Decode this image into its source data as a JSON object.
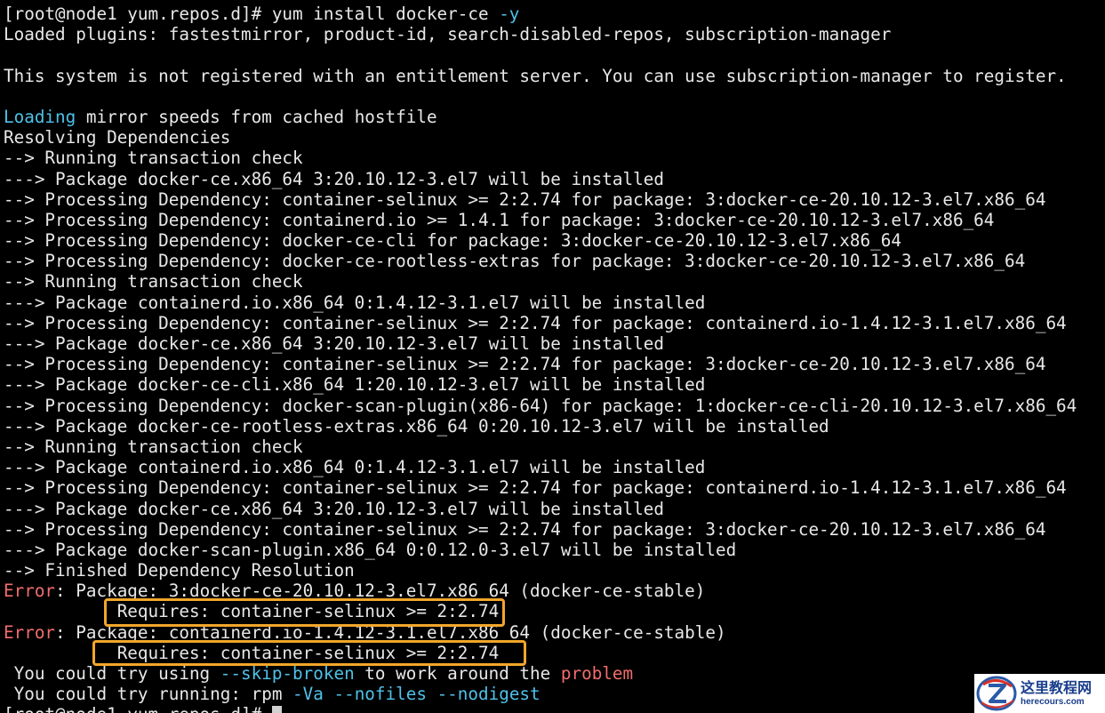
{
  "terminal": {
    "lines": [
      [
        {
          "t": "[root@node1 yum.repos.d]# yum install docker-ce "
        },
        {
          "t": "-y",
          "c": "cyan"
        }
      ],
      [
        {
          "t": "Loaded plugins: fastestmirror, product-id, search-disabled-repos, subscription-manager"
        }
      ],
      [],
      [
        {
          "t": "This system is not registered with an entitlement server. You can use subscription-manager to register."
        }
      ],
      [],
      [
        {
          "t": "Loading",
          "c": "cyan"
        },
        {
          "t": " mirror speeds from cached hostfile"
        }
      ],
      [
        {
          "t": "Resolving Dependencies"
        }
      ],
      [
        {
          "t": "--> Running transaction check"
        }
      ],
      [
        {
          "t": "---> Package docker-ce.x86_64 3:20.10.12-3.el7 will be installed"
        }
      ],
      [
        {
          "t": "--> Processing Dependency: container-selinux >= 2:2.74 for package: 3:docker-ce-20.10.12-3.el7.x86_64"
        }
      ],
      [
        {
          "t": "--> Processing Dependency: containerd.io >= 1.4.1 for package: 3:docker-ce-20.10.12-3.el7.x86_64"
        }
      ],
      [
        {
          "t": "--> Processing Dependency: docker-ce-cli for package: 3:docker-ce-20.10.12-3.el7.x86_64"
        }
      ],
      [
        {
          "t": "--> Processing Dependency: docker-ce-rootless-extras for package: 3:docker-ce-20.10.12-3.el7.x86_64"
        }
      ],
      [
        {
          "t": "--> Running transaction check"
        }
      ],
      [
        {
          "t": "---> Package containerd.io.x86_64 0:1.4.12-3.1.el7 will be installed"
        }
      ],
      [
        {
          "t": "--> Processing Dependency: container-selinux >= 2:2.74 for package: containerd.io-1.4.12-3.1.el7.x86_64"
        }
      ],
      [
        {
          "t": "---> Package docker-ce.x86_64 3:20.10.12-3.el7 will be installed"
        }
      ],
      [
        {
          "t": "--> Processing Dependency: container-selinux >= 2:2.74 for package: 3:docker-ce-20.10.12-3.el7.x86_64"
        }
      ],
      [
        {
          "t": "---> Package docker-ce-cli.x86_64 1:20.10.12-3.el7 will be installed"
        }
      ],
      [
        {
          "t": "--> Processing Dependency: docker-scan-plugin(x86-64) for package: 1:docker-ce-cli-20.10.12-3.el7.x86_64"
        }
      ],
      [
        {
          "t": "---> Package docker-ce-rootless-extras.x86_64 0:20.10.12-3.el7 will be installed"
        }
      ],
      [
        {
          "t": "--> Running transaction check"
        }
      ],
      [
        {
          "t": "---> Package containerd.io.x86_64 0:1.4.12-3.1.el7 will be installed"
        }
      ],
      [
        {
          "t": "--> Processing Dependency: container-selinux >= 2:2.74 for package: containerd.io-1.4.12-3.1.el7.x86_64"
        }
      ],
      [
        {
          "t": "---> Package docker-ce.x86_64 3:20.10.12-3.el7 will be installed"
        }
      ],
      [
        {
          "t": "--> Processing Dependency: container-selinux >= 2:2.74 for package: 3:docker-ce-20.10.12-3.el7.x86_64"
        }
      ],
      [
        {
          "t": "---> Package docker-scan-plugin.x86_64 0:0.12.0-3.el7 will be installed"
        }
      ],
      [
        {
          "t": "--> Finished Dependency Resolution"
        }
      ],
      [
        {
          "t": "Error",
          "c": "red"
        },
        {
          "t": ": Package: 3:docker-ce-20.10.12-3.el7.x86_64 (docker-ce-stable)"
        }
      ],
      [
        {
          "t": "           Requires: container-selinux >= 2:2.74"
        }
      ],
      [
        {
          "t": "Error",
          "c": "red"
        },
        {
          "t": ": Package: containerd.io-1.4.12-3.1.el7.x86_64 (docker-ce-stable)"
        }
      ],
      [
        {
          "t": "           Requires: container-selinux >= 2:2.74"
        }
      ],
      [
        {
          "t": " You could try using "
        },
        {
          "t": "--skip-broken",
          "c": "cyan"
        },
        {
          "t": " to work around the "
        },
        {
          "t": "problem",
          "c": "red"
        }
      ],
      [
        {
          "t": " You could try running: rpm "
        },
        {
          "t": "-Va --nofiles --nodigest",
          "c": "cyan"
        }
      ],
      [
        {
          "t": "[root@node1 yum.repos.d]# "
        },
        {
          "cursor": true
        }
      ]
    ]
  },
  "colors": {
    "background": "#000000",
    "foreground": "#e8e8e8",
    "cyan": "#4fc1e9",
    "red": "#f26d6d",
    "highlight_box": "#f2a62a"
  },
  "watermark": {
    "cn_text": "这里教程网",
    "en_text": "herecours.com",
    "icon": "logo-icon"
  }
}
